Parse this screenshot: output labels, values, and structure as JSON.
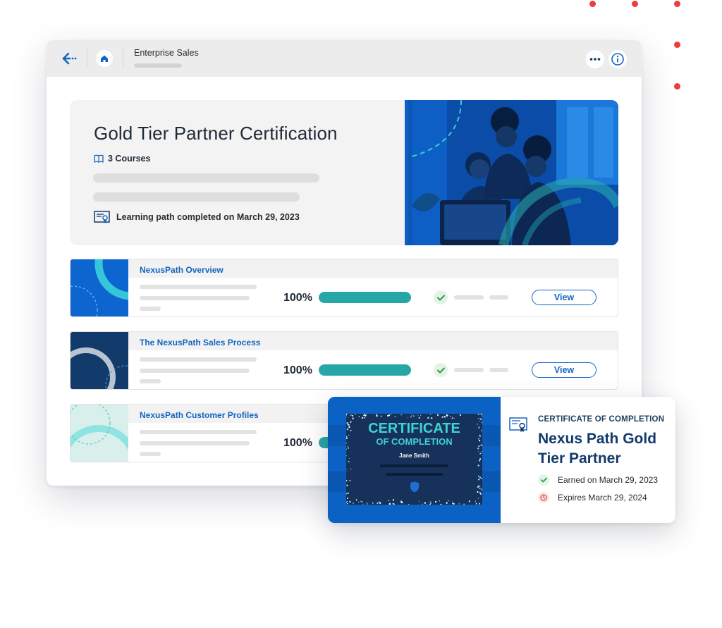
{
  "window": {
    "title": "Enterprise Sales"
  },
  "hero": {
    "title": "Gold Tier Partner Certification",
    "courses": "3 Courses",
    "completed": "Learning path completed on March 29, 2023"
  },
  "courses": [
    {
      "title": "NexusPath Overview",
      "progress": "100%",
      "progress_value": 100,
      "action": "View"
    },
    {
      "title": "The NexusPath Sales Process",
      "progress": "100%",
      "progress_value": 100,
      "action": "View"
    },
    {
      "title": "NexusPath Customer Profiles",
      "progress": "100%",
      "progress_value": 100
    }
  ],
  "certificate": {
    "preview_title_line1": "CERTIFICATE",
    "preview_title_line2": "OF COMPLETION",
    "preview_recipient": "Jane Smith",
    "kicker": "CERTIFICATE OF COMPLETION",
    "name": "Nexus Path Gold Tier Partner",
    "earned": "Earned on March 29, 2023",
    "expires": "Expires March 29, 2024"
  },
  "colors": {
    "accent_blue": "#1565c0",
    "progress_teal": "#26a6a6",
    "decor_dots": "#ef3b3b",
    "check_green": "#2e9d4a",
    "expire_red": "#e04848"
  }
}
